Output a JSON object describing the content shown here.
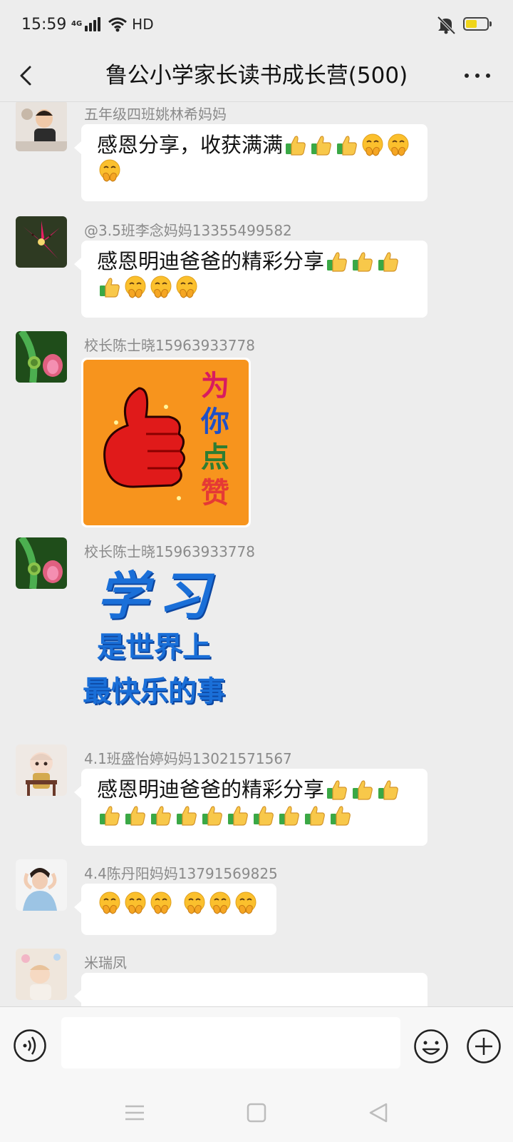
{
  "status_bar": {
    "time": "15:59",
    "network": "4G",
    "hd": "HD",
    "battery_level": 0.55,
    "battery_color": "#f0d51a"
  },
  "header": {
    "title": "鲁公小学家长读书成长营(500)"
  },
  "messages": [
    {
      "sender": "五年级四班姚林希妈妈",
      "avatar": "child-photo",
      "type": "text",
      "text": "感恩分享，收获满满",
      "emojis_line1": [
        "thumbs-up",
        "thumbs-up",
        "thumbs-up",
        "shush-face",
        "shush-face"
      ],
      "emojis_line2": [
        "shush-face"
      ]
    },
    {
      "sender": "@3.5班李念妈妈13355499582",
      "avatar": "lily-flower",
      "type": "text",
      "text": "感恩明迪爸爸的精彩分享",
      "emojis_line1": [
        "thumbs-up",
        "thumbs-up",
        "thumbs-up"
      ],
      "emojis_line2": [
        "thumbs-up",
        "shush-face",
        "shush-face",
        "shush-face"
      ]
    },
    {
      "sender": "校长陈士晓15963933778",
      "avatar": "lotus",
      "type": "sticker",
      "sticker": {
        "name": "thumbs-up-sticker",
        "text_chars": [
          "为",
          "你",
          "点",
          "赞"
        ],
        "background": "#f7941d"
      }
    },
    {
      "sender": "校长陈士晓15963933778",
      "avatar": "lotus",
      "type": "sticker",
      "sticker": {
        "name": "text-sticker",
        "lines": [
          "学习",
          "是世界上",
          "最快乐的事"
        ],
        "color": "#1a6fd8"
      }
    },
    {
      "sender": "4.1班盛怡婷妈妈13021571567",
      "avatar": "doll",
      "type": "text",
      "text": "感恩明迪爸爸的精彩分享",
      "emojis_line1": [
        "thumbs-up",
        "thumbs-up",
        "thumbs-up"
      ],
      "emojis_line2": [
        "thumbs-up",
        "thumbs-up",
        "thumbs-up",
        "thumbs-up",
        "thumbs-up",
        "thumbs-up",
        "thumbs-up",
        "thumbs-up",
        "thumbs-up",
        "thumbs-up"
      ]
    },
    {
      "sender": "4.4陈丹阳妈妈13791569825",
      "avatar": "woman-photo",
      "type": "text",
      "text": "",
      "emojis_line1": [
        "shush-face",
        "shush-face",
        "shush-face",
        "shush-face",
        "shush-face",
        "shush-face"
      ]
    },
    {
      "sender": "米瑞凤",
      "avatar": "baby-photo",
      "type": "text",
      "text": ""
    }
  ],
  "input_bar": {
    "placeholder": "",
    "value": ""
  },
  "icons": {
    "back": "chevron-left-icon",
    "more": "more-dots-icon",
    "voice": "voice-icon",
    "emoji": "emoji-icon",
    "plus": "plus-icon",
    "nav": [
      "menu-icon",
      "home-icon",
      "back-triangle-icon"
    ]
  }
}
